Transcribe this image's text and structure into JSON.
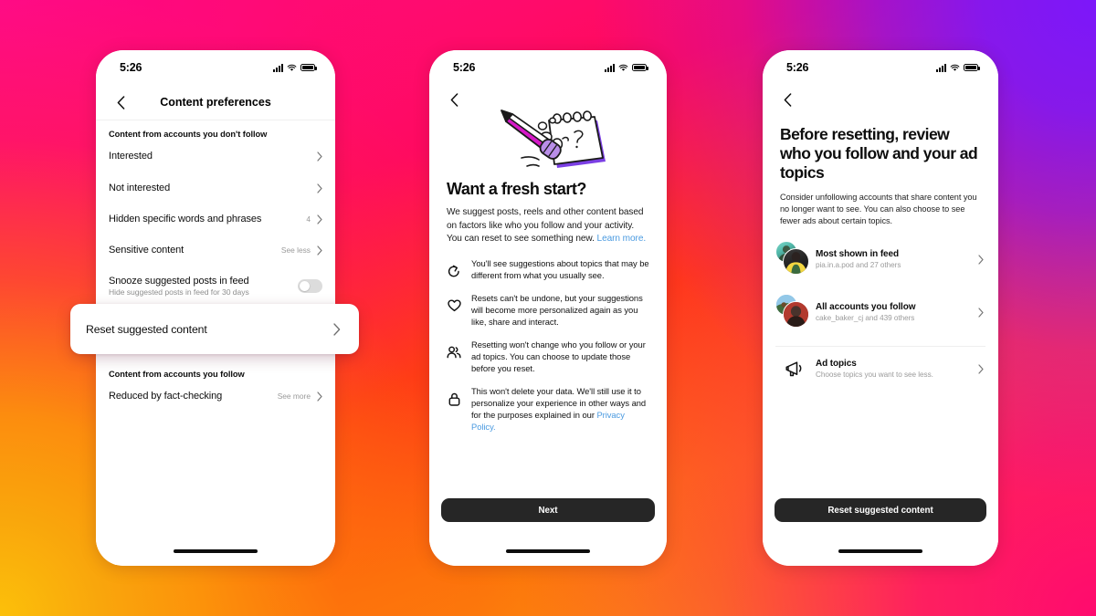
{
  "background": {
    "colors": {
      "top_left_pink": "#ff0a87",
      "top_right_purple": "#7c17fa",
      "bottom_left_yellow": "#f9a60c",
      "bottom_right_pink": "#ff0a6e",
      "mid_red": "#ff3a18"
    }
  },
  "status_bar": {
    "time": "5:26",
    "icons": [
      "cellular-signal-icon",
      "wifi-icon",
      "battery-icon"
    ]
  },
  "phone1": {
    "nav": {
      "back_icon": "chevron-left-icon",
      "title": "Content preferences"
    },
    "section1_header": "Content from accounts you don't follow",
    "rows": [
      {
        "label": "Interested",
        "meta": "",
        "chevron": true
      },
      {
        "label": "Not interested",
        "meta": "",
        "chevron": true
      },
      {
        "label": "Hidden specific words and phrases",
        "meta": "4",
        "chevron": true
      },
      {
        "label": "Sensitive content",
        "meta": "See less",
        "chevron": true
      }
    ],
    "snooze": {
      "label": "Snooze suggested posts in feed",
      "sub": "Hide suggested posts in feed for 30 days",
      "toggle_state": "off"
    },
    "callout": {
      "label": "Reset suggested content",
      "chevron_icon": "chevron-right-icon"
    },
    "section2_header": "Content from accounts you follow",
    "rows2": [
      {
        "label": "Reduced by fact-checking",
        "meta": "See more",
        "chevron": true
      }
    ]
  },
  "phone2": {
    "nav": {
      "back_icon": "chevron-left-icon"
    },
    "illustration": "pencil-erasing-notepad-illustration",
    "title": "Want a fresh start?",
    "body": "We suggest posts, reels and other content based on factors like who you follow and your activity. You can reset to see something new. ",
    "body_link": "Learn more.",
    "bullets": [
      {
        "icon": "refresh-arrow-icon",
        "text": "You'll see suggestions about topics that may be different from what you usually see."
      },
      {
        "icon": "heart-icon",
        "text": "Resets can't be undone, but your suggestions will become more personalized again as you like, share and interact."
      },
      {
        "icon": "people-group-icon",
        "text": "Resetting won't change who you follow or your ad topics. You can choose to update those before you reset."
      },
      {
        "icon": "lock-icon",
        "text": "This won't delete your data. We'll still use it to personalize your experience in other ways and for the purposes explained in our ",
        "link": "Privacy Policy."
      }
    ],
    "cta_label": "Next"
  },
  "phone3": {
    "nav": {
      "back_icon": "chevron-left-icon"
    },
    "title": "Before resetting, review who you follow and your ad topics",
    "subtitle": "Consider unfollowing accounts that share content you no longer want to see. You can also choose to see fewer ads about certain topics.",
    "accounts": [
      {
        "title": "Most shown in feed",
        "sub": "pia.in.a.pod and 27 others",
        "avatar": "stacked-avatars",
        "chevron": true
      },
      {
        "title": "All accounts you follow",
        "sub": "cake_baker_cj and 439 others",
        "avatar": "stacked-avatars",
        "chevron": true
      }
    ],
    "ad_topics": {
      "icon": "megaphone-icon",
      "title": "Ad topics",
      "sub": "Choose topics you want to see less.",
      "chevron": true
    },
    "cta_label": "Reset suggested content"
  }
}
